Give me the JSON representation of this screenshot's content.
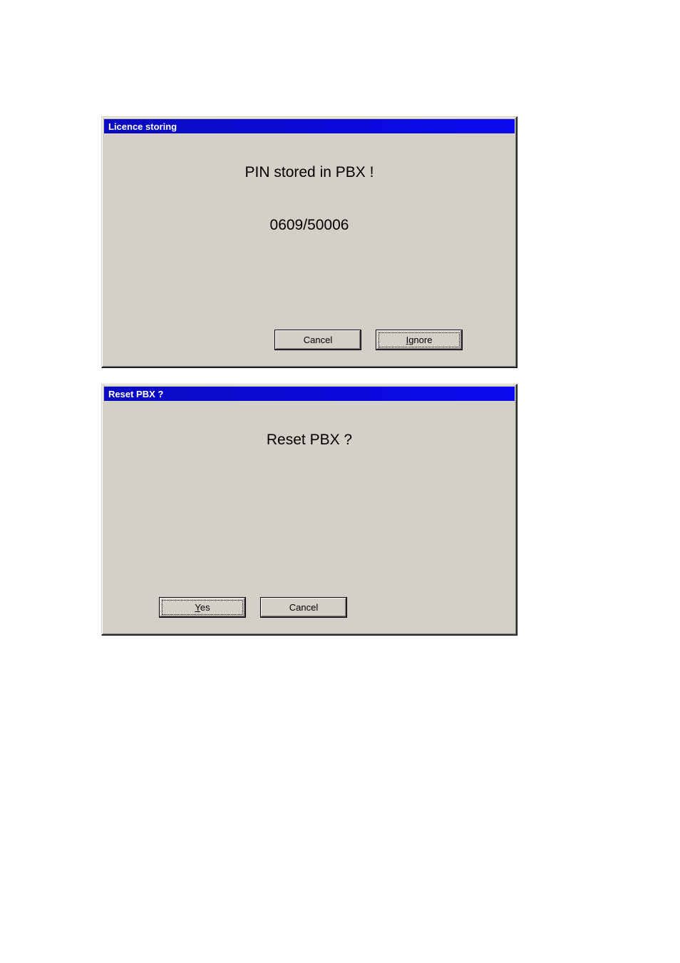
{
  "dialog1": {
    "title": "Licence storing",
    "message_line1": "PIN stored in PBX !",
    "message_line2": "0609/50006",
    "buttons": {
      "cancel": "Cancel",
      "ignore_pre": "I",
      "ignore_post": "gnore"
    }
  },
  "dialog2": {
    "title": "Reset PBX ?",
    "message_line1": "Reset PBX ?",
    "buttons": {
      "yes_pre": "Y",
      "yes_post": "es",
      "cancel": "Cancel"
    }
  }
}
